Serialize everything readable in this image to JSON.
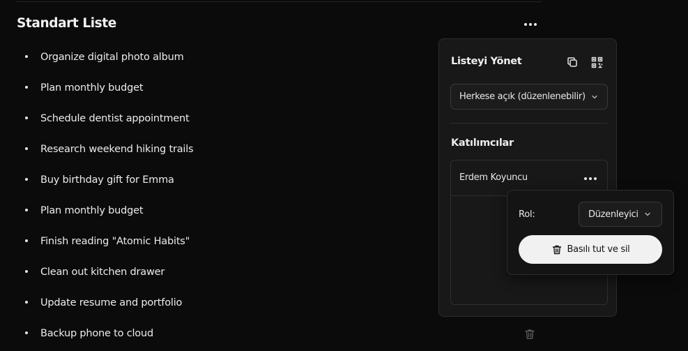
{
  "list": {
    "title": "Standart Liste",
    "items": [
      "Organize digital photo album",
      "Plan monthly budget",
      "Schedule dentist appointment",
      "Research weekend hiking trails",
      "Buy birthday gift for Emma",
      "Plan monthly budget",
      "Finish reading \"Atomic Habits\"",
      "Clean out kitchen drawer",
      "Update resume and portfolio",
      "Backup phone to cloud"
    ]
  },
  "manage": {
    "title": "Listeyi Yönet",
    "visibility_value": "Herkese açık (düzenlenebilir)",
    "participants_title": "Katılımcılar",
    "participants": [
      {
        "name": "Erdem Koyuncu"
      }
    ]
  },
  "role_menu": {
    "role_label": "Rol:",
    "role_value": "Düzenleyici",
    "delete_label": "Basılı tut ve sil"
  },
  "icons": {
    "list_more": "more-horizontal-icon",
    "copy": "copy-icon",
    "qr": "qr-code-icon",
    "chevron": "chevron-down-icon",
    "participant_more": "more-horizontal-icon",
    "trash": "trash-icon"
  },
  "colors": {
    "background": "#0b0b0b",
    "panel": "#181818",
    "popover": "#141414",
    "button_light": "#f1f1f1"
  }
}
